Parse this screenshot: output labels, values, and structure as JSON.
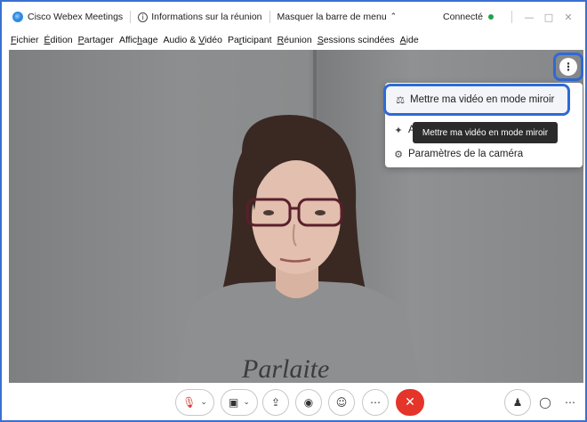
{
  "window": {
    "app_title": "Cisco Webex Meetings",
    "info_label": "Informations sur la réunion",
    "hide_menu_label": "Masquer la barre de menu",
    "status": "Connecté",
    "accent_color": "#2e6ad6",
    "status_color": "#1fa34a"
  },
  "menu": {
    "items": [
      {
        "u": "F",
        "rest": "ichier"
      },
      {
        "u": "É",
        "rest": "dition"
      },
      {
        "u": "P",
        "rest": "artager"
      },
      {
        "pre": "Affic",
        "u": "h",
        "rest": "age"
      },
      {
        "pre": "Audio & ",
        "u": "V",
        "rest": "idéo"
      },
      {
        "pre": "Pa",
        "u": "r",
        "rest": "ticipant"
      },
      {
        "u": "R",
        "rest": "éunion"
      },
      {
        "u": "S",
        "rest": "essions scindées"
      },
      {
        "u": "A",
        "rest": "ide"
      }
    ]
  },
  "video": {
    "shirt_text": "Parlaite",
    "more_icon": "⋮"
  },
  "dropdown": {
    "items": [
      {
        "label": "Mettre ma vidéo en mode miroir",
        "icon": "mirror-icon"
      },
      {
        "label": "A",
        "icon": "magic-wand-icon"
      },
      {
        "label": "Paramètres de la caméra",
        "icon": "gear-icon"
      }
    ],
    "tooltip": "Mettre ma vidéo en mode miroir"
  },
  "toolbar": {
    "end_color": "#e5342a",
    "buttons": [
      "mute-mic",
      "video",
      "share",
      "record",
      "reactions",
      "more",
      "end-meeting",
      "participants",
      "chat",
      "more-right"
    ]
  }
}
